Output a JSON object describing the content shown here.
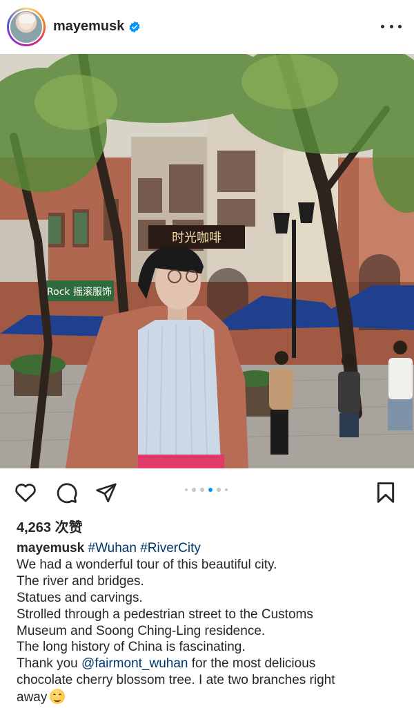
{
  "post": {
    "username": "mayemusk",
    "likes_text": "4,263 次赞",
    "carousel": {
      "count": 6,
      "active_index": 3
    }
  },
  "caption": {
    "username": "mayemusk",
    "hashtag_1": "#Wuhan",
    "hashtag_2": "#RiverCity",
    "line_1": "We had a wonderful tour of this beautiful city.",
    "line_2": "The river and bridges.",
    "line_3": "Statues and carvings.",
    "line_4": "Strolled through a pedestrian street to the Customs",
    "line_5": "Museum and Soong Ching-Ling residence.",
    "line_6": "The long history of China is fascinating.",
    "line_7_pre": "Thank you ",
    "mention": "@fairmont_wuhan",
    "line_7_post": " for the most delicious",
    "line_8": "chocolate cherry blossom tree. I ate two branches right",
    "line_9": "away"
  },
  "photo": {
    "sign_cafe": "时光咖啡",
    "sign_shop": "Rock 摇滚服饰"
  },
  "icons": {
    "verified": "verified-badge-icon",
    "more": "more-options-icon",
    "like": "heart-icon",
    "comment": "comment-icon",
    "share": "send-icon",
    "save": "bookmark-icon",
    "emoji": "smiling-face-emoji"
  },
  "colors": {
    "verified_blue": "#0095f6",
    "link": "#00376b",
    "text": "#262626",
    "coat": "#b86c56",
    "sweater": "#cdd8e6",
    "umbrella": "#1f3f8f"
  }
}
